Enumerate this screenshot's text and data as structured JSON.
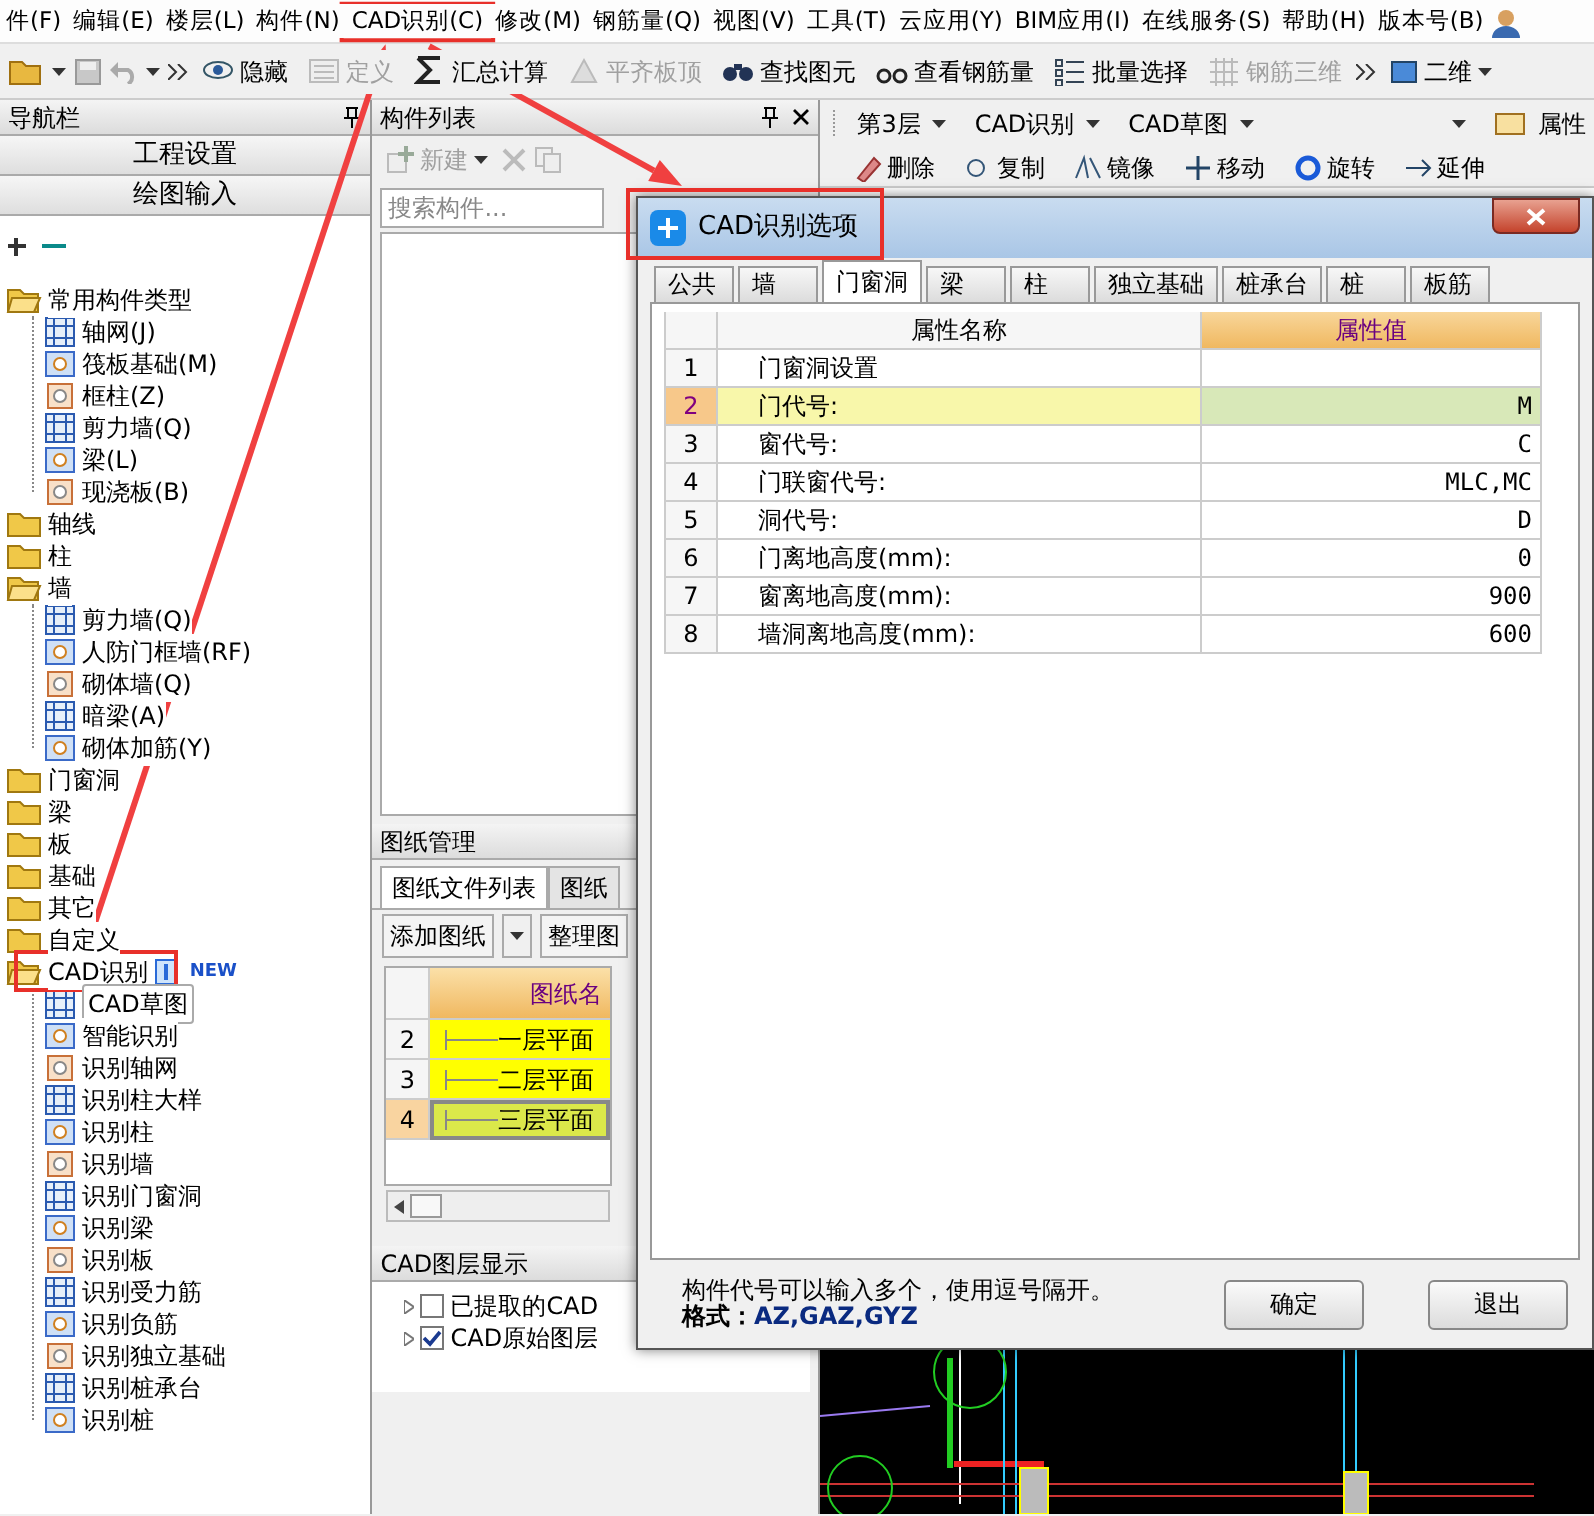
{
  "menu": [
    "件(F)",
    "编辑(E)",
    "楼层(L)",
    "构件(N)",
    "CAD识别(C)",
    "修改(M)",
    "钢筋量(Q)",
    "视图(V)",
    "工具(T)",
    "云应用(Y)",
    "BIM应用(I)",
    "在线服务(S)",
    "帮助(H)",
    "版本号(B)"
  ],
  "toolbar": {
    "buttons": [
      {
        "label": "隐藏",
        "disabled": false
      },
      {
        "label": "定义",
        "disabled": true
      },
      {
        "label": "汇总计算",
        "disabled": false
      },
      {
        "label": "平齐板顶",
        "disabled": true
      },
      {
        "label": "查找图元",
        "disabled": false
      },
      {
        "label": "查看钢筋量",
        "disabled": false
      },
      {
        "label": "批量选择",
        "disabled": false
      },
      {
        "label": "钢筋三维",
        "disabled": true
      }
    ],
    "view_select": "二维"
  },
  "nav": {
    "title": "导航栏",
    "sections": [
      "工程设置",
      "绘图输入"
    ],
    "tree": [
      {
        "kind": "folder",
        "label": "常用构件类型",
        "expanded": true,
        "children": [
          {
            "kind": "item",
            "label": "轴网(J)"
          },
          {
            "kind": "item",
            "label": "筏板基础(M)"
          },
          {
            "kind": "item",
            "label": "框柱(Z)"
          },
          {
            "kind": "item",
            "label": "剪力墙(Q)"
          },
          {
            "kind": "item",
            "label": "梁(L)"
          },
          {
            "kind": "item",
            "label": "现浇板(B)"
          }
        ]
      },
      {
        "kind": "folder",
        "label": "轴线",
        "expanded": false
      },
      {
        "kind": "folder",
        "label": "柱",
        "expanded": false
      },
      {
        "kind": "folder",
        "label": "墙",
        "expanded": true,
        "children": [
          {
            "kind": "item",
            "label": "剪力墙(Q)"
          },
          {
            "kind": "item",
            "label": "人防门框墙(RF)"
          },
          {
            "kind": "item",
            "label": "砌体墙(Q)"
          },
          {
            "kind": "item",
            "label": "暗梁(A)"
          },
          {
            "kind": "item",
            "label": "砌体加筋(Y)"
          }
        ]
      },
      {
        "kind": "folder",
        "label": "门窗洞",
        "expanded": false
      },
      {
        "kind": "folder",
        "label": "梁",
        "expanded": false
      },
      {
        "kind": "folder",
        "label": "板",
        "expanded": false
      },
      {
        "kind": "folder",
        "label": "基础",
        "expanded": false
      },
      {
        "kind": "folder",
        "label": "其它",
        "expanded": false
      },
      {
        "kind": "folder",
        "label": "自定义",
        "expanded": false
      },
      {
        "kind": "folder",
        "label": "CAD识别",
        "expanded": true,
        "badge": "NEW",
        "children": [
          {
            "kind": "item",
            "label": "CAD草图",
            "selected": true
          },
          {
            "kind": "item",
            "label": "智能识别",
            "selected": false
          },
          {
            "kind": "item",
            "label": "识别轴网",
            "selected": false
          },
          {
            "kind": "item",
            "label": "识别柱大样",
            "selected": false
          },
          {
            "kind": "item",
            "label": "识别柱",
            "selected": false
          },
          {
            "kind": "item",
            "label": "识别墙",
            "selected": false
          },
          {
            "kind": "item",
            "label": "识别门窗洞",
            "selected": false
          },
          {
            "kind": "item",
            "label": "识别梁",
            "selected": false
          },
          {
            "kind": "item",
            "label": "识别板",
            "selected": false
          },
          {
            "kind": "item",
            "label": "识别受力筋",
            "selected": false
          },
          {
            "kind": "item",
            "label": "识别负筋",
            "selected": false
          },
          {
            "kind": "item",
            "label": "识别独立基础",
            "selected": false
          },
          {
            "kind": "item",
            "label": "识别桩承台",
            "selected": false
          },
          {
            "kind": "item",
            "label": "识别桩",
            "selected": false
          }
        ]
      }
    ]
  },
  "components": {
    "title": "构件列表",
    "new_label": "新建",
    "search_placeholder": "搜索构件..."
  },
  "drawings": {
    "title": "图纸管理",
    "tabs": [
      {
        "label": "图纸文件列表",
        "selected": true
      },
      {
        "label": "图纸",
        "selected": false
      }
    ],
    "buttons": [
      "添加图纸",
      "整理图"
    ],
    "column": "图纸名",
    "rows": [
      {
        "index": "2",
        "name": "一层平面",
        "selected": false
      },
      {
        "index": "3",
        "name": "二层平面",
        "selected": false
      },
      {
        "index": "4",
        "name": "三层平面",
        "selected": true
      }
    ]
  },
  "cad_layers": {
    "title": "CAD图层显示",
    "items": [
      {
        "label": "已提取的CAD",
        "checked": false
      },
      {
        "label": "CAD原始图层",
        "checked": true
      }
    ]
  },
  "right_toolbar": {
    "floor": "第3层",
    "category": "CAD识别",
    "sub": "CAD草图",
    "property": "属性",
    "tools": [
      "删除",
      "复制",
      "镜像",
      "移动",
      "旋转",
      "延伸"
    ]
  },
  "dialog": {
    "title": "CAD识别选项",
    "tabs": [
      {
        "label": "公共",
        "selected": false
      },
      {
        "label": "墙",
        "selected": false
      },
      {
        "label": "门窗洞",
        "selected": true
      },
      {
        "label": "梁",
        "selected": false
      },
      {
        "label": "柱",
        "selected": false
      },
      {
        "label": "独立基础",
        "selected": false
      },
      {
        "label": "桩承台",
        "selected": false
      },
      {
        "label": "桩",
        "selected": false
      },
      {
        "label": "板筋",
        "selected": false
      }
    ],
    "columns": [
      "属性名称",
      "属性值"
    ],
    "rows": [
      {
        "index": "1",
        "name": "门窗洞设置",
        "selected": false
      },
      {
        "index": "2",
        "name": "门代号:",
        "value": "M",
        "selected": true
      },
      {
        "index": "3",
        "name": "窗代号:",
        "value": "C",
        "selected": false
      },
      {
        "index": "4",
        "name": "门联窗代号:",
        "value": "MLC,MC",
        "selected": false
      },
      {
        "index": "5",
        "name": "洞代号:",
        "value": "D",
        "selected": false
      },
      {
        "index": "6",
        "name": "门离地高度(mm):",
        "value": "0",
        "selected": false
      },
      {
        "index": "7",
        "name": "窗离地高度(mm):",
        "value": "900",
        "selected": false
      },
      {
        "index": "8",
        "name": "墙洞离地高度(mm):",
        "value": "600",
        "selected": false
      }
    ],
    "note": "构件代号可以输入多个，使用逗号隔开。",
    "format_label": "格式：",
    "format_value": "AZ,GAZ,GYZ",
    "buttons": [
      "确定",
      "退出"
    ]
  }
}
